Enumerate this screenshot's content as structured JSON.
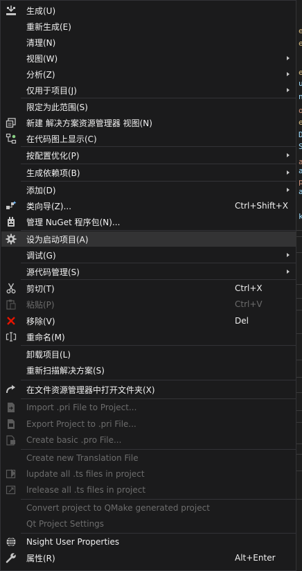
{
  "editor": {
    "glyphs": [
      "e",
      "e",
      "e",
      "u",
      "n",
      "o",
      "e",
      "D",
      "S",
      "a",
      "a",
      "p",
      "a",
      "k"
    ]
  },
  "menu": {
    "items": [
      {
        "id": "build",
        "label": "生成(U)",
        "icon": "build-icon"
      },
      {
        "id": "rebuild",
        "label": "重新生成(E)"
      },
      {
        "id": "clean",
        "label": "清理(N)"
      },
      {
        "id": "view",
        "label": "视图(W)",
        "submenu": true
      },
      {
        "id": "analyze",
        "label": "分析(Z)",
        "submenu": true
      },
      {
        "id": "project-only",
        "label": "仅用于项目(J)",
        "submenu": true
      },
      {
        "id": "scope-to-this",
        "label": "限定为此范围(S)"
      },
      {
        "id": "new-solution-explorer-view",
        "label": "新建 解决方案资源管理器 视图(N)",
        "icon": "new-window-icon"
      },
      {
        "id": "show-on-code-map",
        "label": "在代码图上显示(C)",
        "icon": "code-map-icon"
      },
      {
        "id": "profile-guided-optimization",
        "label": "按配置优化(P)",
        "submenu": true
      },
      {
        "id": "build-dependencies",
        "label": "生成依赖项(B)",
        "submenu": true
      },
      {
        "id": "add",
        "label": "添加(D)",
        "submenu": true
      },
      {
        "id": "class-wizard",
        "label": "类向导(Z)...",
        "shortcut": "Ctrl+Shift+X",
        "icon": "class-wizard-icon"
      },
      {
        "id": "manage-nuget",
        "label": "管理 NuGet 程序包(N)...",
        "icon": "nuget-icon"
      },
      {
        "id": "set-startup-project",
        "label": "设为启动项目(A)",
        "icon": "gear-icon",
        "highlighted": true
      },
      {
        "id": "debug",
        "label": "调试(G)",
        "submenu": true
      },
      {
        "id": "source-control",
        "label": "源代码管理(S)",
        "submenu": true
      },
      {
        "id": "cut",
        "label": "剪切(T)",
        "shortcut": "Ctrl+X",
        "icon": "scissors-icon"
      },
      {
        "id": "paste",
        "label": "粘贴(P)",
        "shortcut": "Ctrl+V",
        "icon": "paste-icon",
        "disabled": true
      },
      {
        "id": "remove",
        "label": "移除(V)",
        "shortcut": "Del",
        "icon": "remove-icon"
      },
      {
        "id": "rename",
        "label": "重命名(M)",
        "icon": "rename-icon"
      },
      {
        "id": "unload-project",
        "label": "卸载项目(L)"
      },
      {
        "id": "rescan-solution",
        "label": "重新扫描解决方案(S)"
      },
      {
        "id": "open-in-file-explorer",
        "label": "在文件资源管理器中打开文件夹(X)",
        "icon": "open-folder-arrow-icon"
      },
      {
        "id": "import-pri",
        "label": "Import .pri File to Project...",
        "icon": "qt-import-icon",
        "disabled": true
      },
      {
        "id": "export-pri",
        "label": "Export Project to .pri File...",
        "icon": "qt-export-icon",
        "disabled": true
      },
      {
        "id": "create-pro",
        "label": "Create basic .pro File...",
        "icon": "qt-pro-icon",
        "disabled": true
      },
      {
        "id": "create-translation",
        "label": "Create new Translation File",
        "disabled": true
      },
      {
        "id": "lupdate",
        "label": "lupdate all .ts files in project",
        "icon": "qt-lupdate-icon",
        "disabled": true
      },
      {
        "id": "lrelease",
        "label": "lrelease all .ts files in project",
        "icon": "qt-lrelease-icon",
        "disabled": true
      },
      {
        "id": "convert-qmake",
        "label": "Convert project to QMake generated project",
        "disabled": true
      },
      {
        "id": "qt-project-settings",
        "label": "Qt Project Settings",
        "disabled": true
      },
      {
        "id": "nsight-properties",
        "label": "Nsight User Properties",
        "icon": "nsight-globe-icon"
      },
      {
        "id": "properties",
        "label": "属性(R)",
        "shortcut": "Alt+Enter",
        "icon": "wrench-icon"
      }
    ]
  }
}
